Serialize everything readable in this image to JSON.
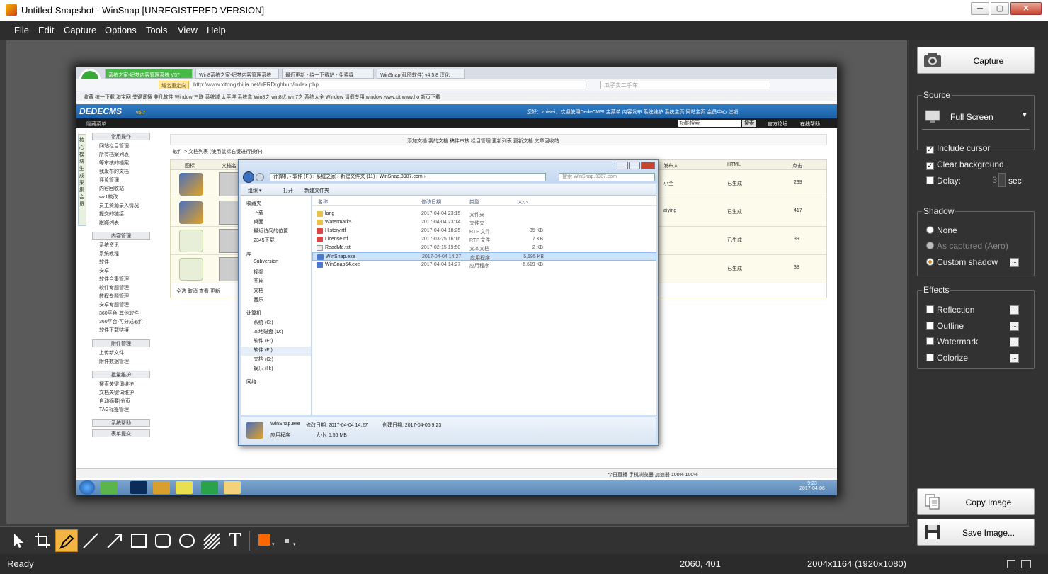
{
  "window": {
    "title": "Untitled Snapshot - WinSnap  [UNREGISTERED VERSION]",
    "min": "─",
    "max": "▢",
    "close": "✕"
  },
  "menu": [
    "File",
    "Edit",
    "Capture",
    "Options",
    "Tools",
    "View",
    "Help"
  ],
  "snapshot": {
    "browser_tabs": [
      "系统之家-织梦内容管理系统 V57",
      "Win8系统之家-织梦内容管理系统",
      "最近更新 - 绕一下载站 - 免费绿",
      "WinSnap(截图软件) v4.5.8 汉化"
    ],
    "address": "http://www.xitongzhijia.net/lrFRDrghhuh/index.php",
    "address_tag": "域名重定向",
    "search_placeholder": "瓜子卖二手车",
    "favorites": "收藏  统一下载  淘宝网  关键词搜  非凡软件  Window  三联  系统城  太平洋  系统盒  Win8之  win8优  win7之  系统大全  Window  请假专用  window  www.xit  www.ho  新页下载",
    "cms_logo": "DEDECMS",
    "cms_version": "v5.7",
    "cms_user_line": "您好：zhiwei，欢迎使用DedeCMS!   主菜单   内容发布   系统维护   系统主页   网站主页   会员中心   注销",
    "hide_menu": "隐藏菜单",
    "func_search": "功能搜索",
    "search_btn": "搜索",
    "forum_link": "官方论坛",
    "help_link": "在线帮助",
    "sidebar_tabs": "核心  模块  生成  采集  会员",
    "side_groups": [
      {
        "title": "常用操作",
        "items": [
          "网站栏目管理",
          "所有档案列表",
          "等审核的档案",
          "我发布的文档",
          "评论管理",
          "内容回收站",
          "wz1校改",
          "员工资源录入情况",
          "提交的链接",
          "跟踪列表"
        ]
      },
      {
        "title": "内容管理",
        "items": [
          "系统资讯",
          "系统教程",
          "软件",
          "安卓",
          "软件合集管理",
          "软件专题管理",
          "教程专题管理",
          "安卓专题管理",
          "360平台-其他软件",
          "360平台-可分成软件",
          "软件下载链接"
        ]
      },
      {
        "title": "附件管理",
        "items": [
          "上传新文件",
          "附件数据管理"
        ]
      },
      {
        "title": "批量维护",
        "items": [
          "搜索关键词维护",
          "文档关键词维护",
          "自动摘要|分页",
          "TAG标签管理"
        ]
      },
      {
        "title": "系统帮助",
        "items": []
      },
      {
        "title": "表单提交",
        "items": []
      }
    ],
    "content_buttons": "添加文档  我的文档  稿件审核  栏目管理  更新列表  更新文档  文章回收站",
    "breadcrumb": "软件 > 文档列表   (使用鼠标右键进行操作)",
    "grid_headers": [
      "图标",
      "文档名",
      "发布人",
      "HTML",
      "点击"
    ],
    "grid_rows": [
      {
        "publisher": "小兰",
        "html": "已生成",
        "clicks": "239"
      },
      {
        "publisher": "aiying",
        "html": "已生成",
        "clicks": "417"
      },
      {
        "publisher": "",
        "html": "已生成",
        "clicks": "39"
      },
      {
        "publisher": "",
        "html": "已生成",
        "clicks": "38"
      }
    ],
    "grid_actions": "全选  取消  查看  更新",
    "bottom_status": "今日直播   手机浏览器   加速器   100%   100%",
    "clock_time": "9:23",
    "clock_date": "2017-04-06",
    "explorer": {
      "path": "计算机 › 软件 (F:) › 系统之家 › 新建文件夹 (11) › WinSnap.3987.com ›",
      "search": "搜索 WinSnap.3987.com",
      "organize": "组织 ▾",
      "open": "打开",
      "new_folder": "新建文件夹",
      "nav": [
        {
          "head": "收藏夹",
          "items": [
            "下载",
            "桌面",
            "最近访问的位置",
            "2345下载"
          ]
        },
        {
          "head": "库",
          "items": [
            "Subversion",
            "视频",
            "图片",
            "文档",
            "音乐"
          ]
        },
        {
          "head": "计算机",
          "items": [
            "系统 (C:)",
            "本地磁盘 (D:)",
            "软件 (E:)",
            "软件 (F:)",
            "文档 (G:)",
            "娱乐 (H:)"
          ]
        },
        {
          "head": "网络",
          "items": []
        }
      ],
      "headers": [
        "名称",
        "修改日期",
        "类型",
        "大小"
      ],
      "files": [
        {
          "name": "lang",
          "date": "2017-04-04 23:15",
          "type": "文件夹",
          "size": ""
        },
        {
          "name": "Watermarks",
          "date": "2017-04-04 23:14",
          "type": "文件夹",
          "size": ""
        },
        {
          "name": "History.rtf",
          "date": "2017-04-04 18:25",
          "type": "RTF 文件",
          "size": "35 KB"
        },
        {
          "name": "License.rtf",
          "date": "2017-03-25 16:16",
          "type": "RTF 文件",
          "size": "7 KB"
        },
        {
          "name": "ReadMe.txt",
          "date": "2017-02-15 19:50",
          "type": "文本文档",
          "size": "2 KB"
        },
        {
          "name": "WinSnap.exe",
          "date": "2017-04-04 14:27",
          "type": "应用程序",
          "size": "5,695 KB"
        },
        {
          "name": "WinSnap64.exe",
          "date": "2017-04-04 14:27",
          "type": "应用程序",
          "size": "6,619 KB"
        }
      ],
      "details_name": "WinSnap.exe",
      "details_type": "应用程序",
      "details_modified": "修改日期: 2017-04-04 14:27",
      "details_created": "创建日期: 2017-04-06 9:23",
      "details_size": "大小: 5.56 MB"
    }
  },
  "panel": {
    "capture_btn": "Capture",
    "source_label": "Source",
    "source_value": "Full Screen",
    "include_cursor": "Include cursor",
    "clear_background": "Clear background",
    "delay": "Delay:",
    "delay_value": "3",
    "delay_unit": "sec",
    "shadow_label": "Shadow",
    "shadow_none": "None",
    "shadow_aero": "As captured (Aero)",
    "shadow_custom": "Custom shadow",
    "effects_label": "Effects",
    "effects": [
      "Reflection",
      "Outline",
      "Watermark",
      "Colorize"
    ],
    "copy_btn": "Copy Image",
    "save_btn": "Save Image...",
    "dots": "..."
  },
  "tools": {
    "accent_color": "#ff6600",
    "text_tool": "T"
  },
  "status": {
    "ready": "Ready",
    "coords": "2060, 401",
    "dimensions": "2004x1164 (1920x1080)"
  }
}
